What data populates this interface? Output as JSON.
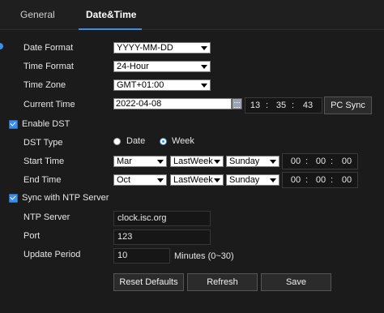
{
  "tabs": {
    "general": "General",
    "datetime": "Date&Time"
  },
  "labels": {
    "date_format": "Date Format",
    "time_format": "Time Format",
    "time_zone": "Time Zone",
    "current_time": "Current Time",
    "enable_dst": "Enable DST",
    "dst_type": "DST Type",
    "start_time": "Start Time",
    "end_time": "End Time",
    "sync_ntp": "Sync with NTP Server",
    "ntp_server": "NTP Server",
    "port": "Port",
    "update_period": "Update Period"
  },
  "values": {
    "date_format": "YYYY-MM-DD",
    "time_format": "24-Hour",
    "time_zone": "GMT+01:00",
    "current_date": "2022-04-08",
    "current_time": {
      "h": "13",
      "m": "35",
      "s": "43"
    },
    "enable_dst_checked": true,
    "dst_type_options": {
      "date": "Date",
      "week": "Week"
    },
    "dst_type_selected": "Week",
    "start": {
      "month": "Mar",
      "week": "LastWeek",
      "day": "Sunday",
      "h": "00",
      "m": "00",
      "s": "00"
    },
    "end": {
      "month": "Oct",
      "week": "LastWeek",
      "day": "Sunday",
      "h": "00",
      "m": "00",
      "s": "00"
    },
    "sync_ntp_checked": true,
    "ntp_server": "clock.isc.org",
    "port": "123",
    "update_period": "10",
    "update_period_unit": "Minutes (0~30)",
    "time_sep": ":"
  },
  "buttons": {
    "pc_sync": "PC Sync",
    "reset": "Reset Defaults",
    "refresh": "Refresh",
    "save": "Save"
  },
  "colors": {
    "accent": "#3d8ee8",
    "background": "#1b1b1b"
  }
}
